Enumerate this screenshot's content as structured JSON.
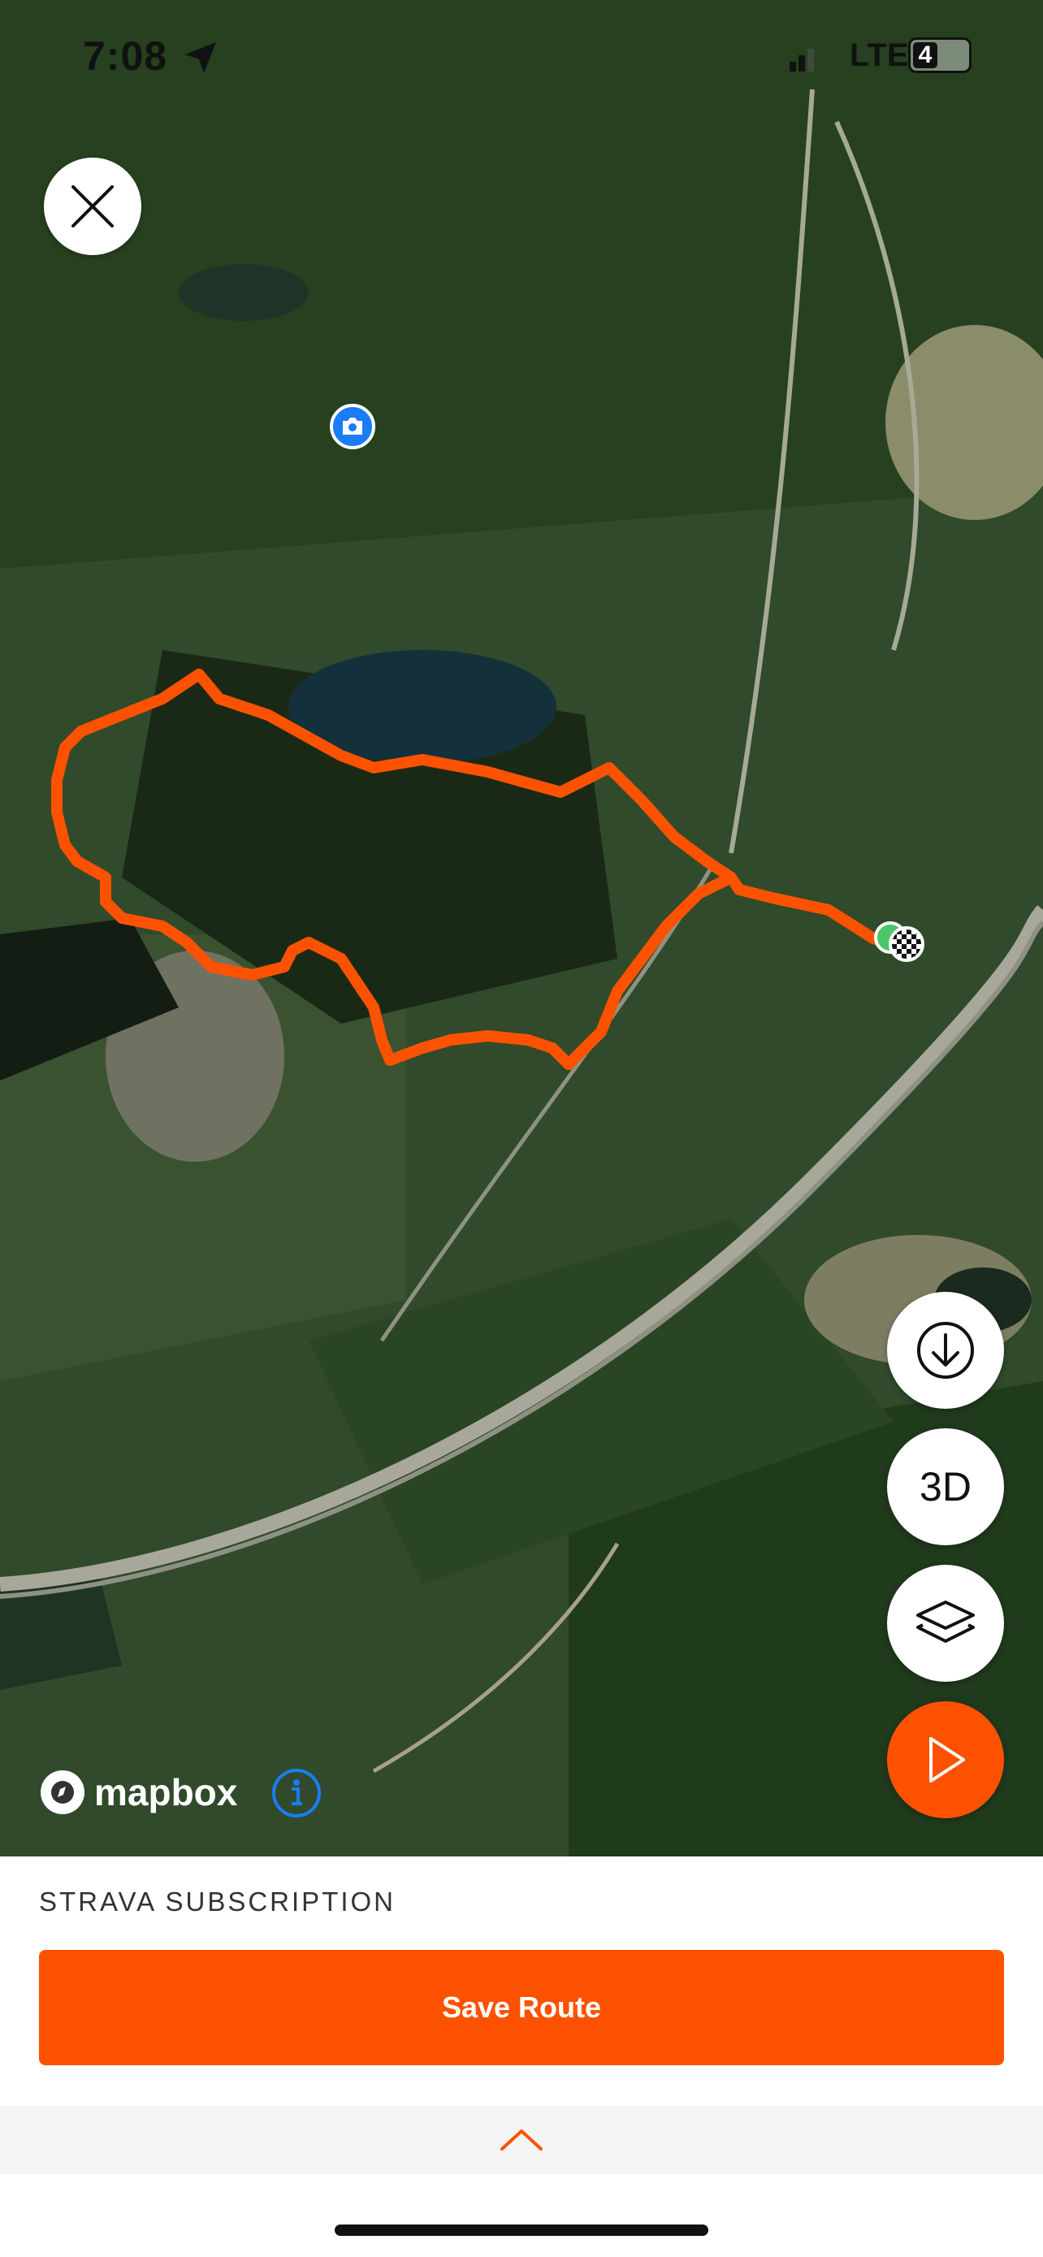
{
  "status_bar": {
    "time": "7:08",
    "carrier": "LTE",
    "battery": "4"
  },
  "map": {
    "attribution": "mapbox",
    "route_color": "#fc5200",
    "start_marker": "start-dot",
    "finish_marker": "checkered-flag",
    "photo_pin_icon": "camera-icon"
  },
  "controls": {
    "close_icon": "close-icon",
    "download_icon": "download-icon",
    "three_d_label": "3D",
    "layers_icon": "layers-icon",
    "play_icon": "play-icon"
  },
  "footer": {
    "subscription_label": "STRAVA SUBSCRIPTION",
    "save_label": "Save Route",
    "expand_icon": "chevron-up-icon"
  },
  "colors": {
    "accent": "#fc5200",
    "info": "#1a7cf7"
  }
}
